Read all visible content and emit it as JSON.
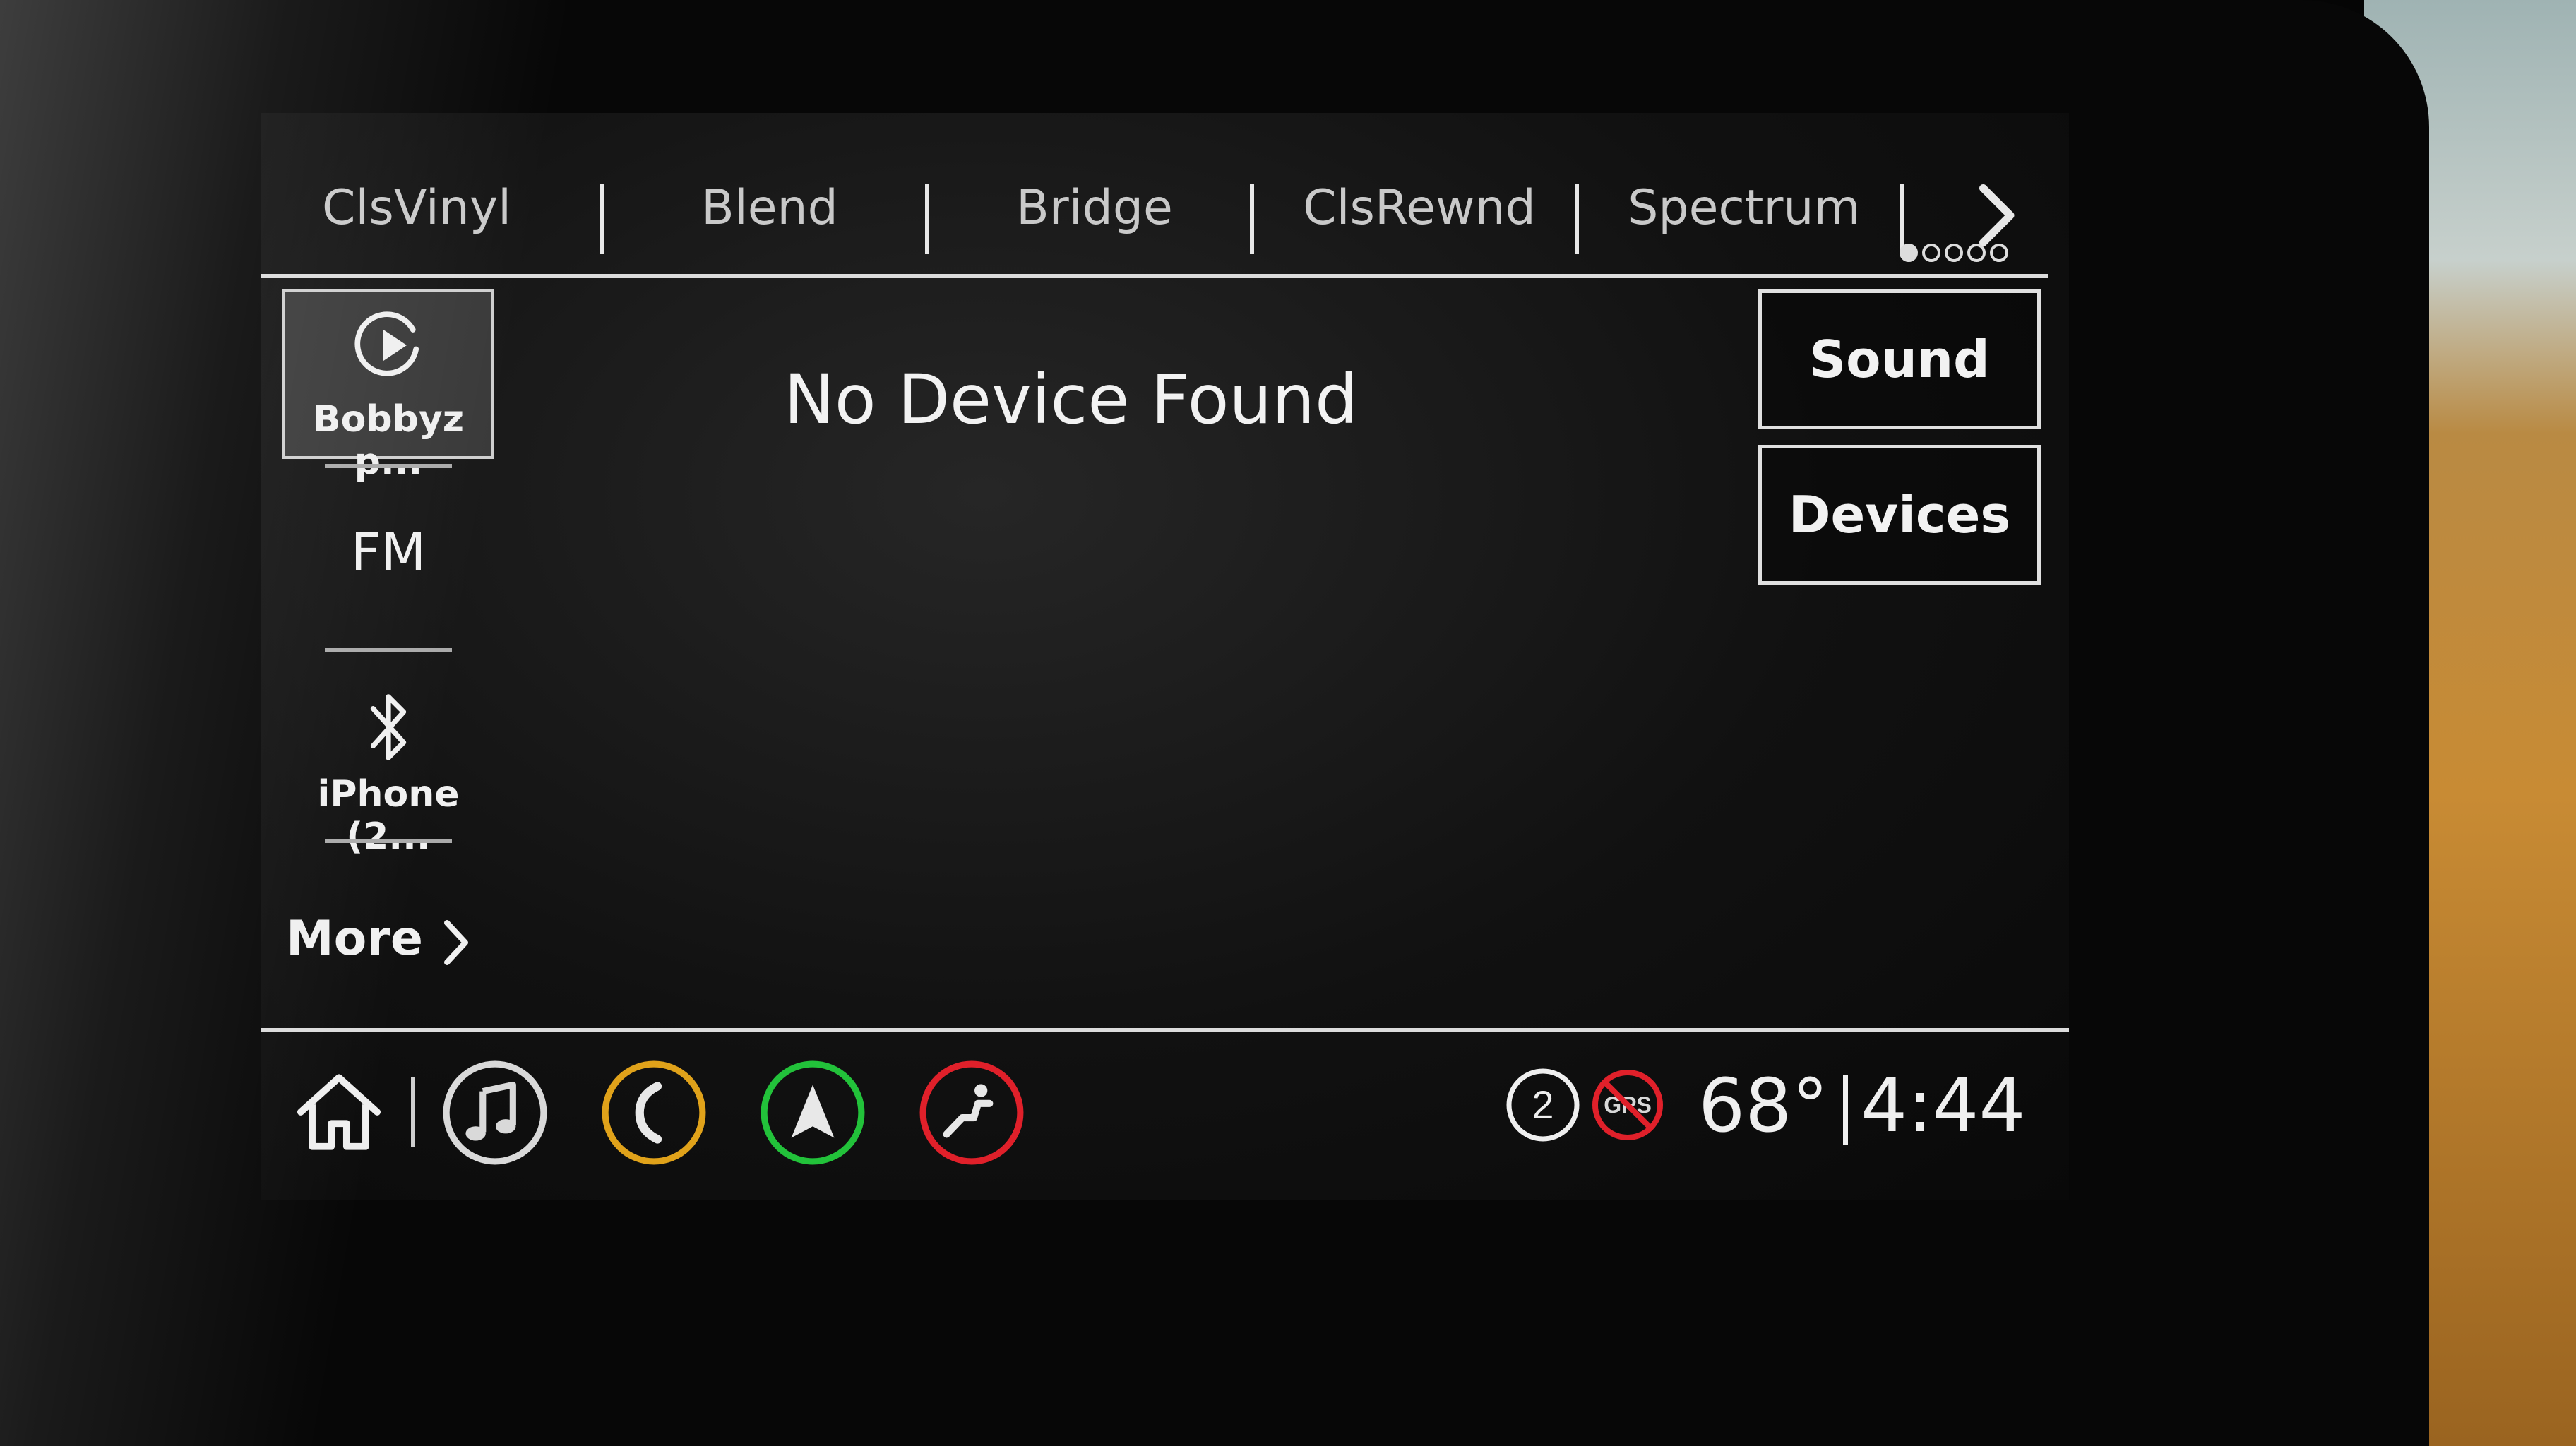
{
  "presets": {
    "items": [
      "ClsVinyl",
      "Blend",
      "Bridge",
      "ClsRewnd",
      "Spectrum"
    ],
    "page_count": 5,
    "active_page": 1
  },
  "sources": {
    "active_label": "Bobbyz p...",
    "fm_label": "FM",
    "bluetooth_label": "iPhone (2...",
    "more_label": "More"
  },
  "main": {
    "message": "No Device Found"
  },
  "buttons": {
    "sound": "Sound",
    "devices": "Devices"
  },
  "status": {
    "notification_count": "2",
    "gps_label": "GPS",
    "temperature": "68°",
    "time": "4:44"
  },
  "icons": {
    "audio_color": "#d9d9d9",
    "phone_color": "#e0a21a",
    "nav_color": "#22c23a",
    "apps_color": "#e0202a"
  }
}
